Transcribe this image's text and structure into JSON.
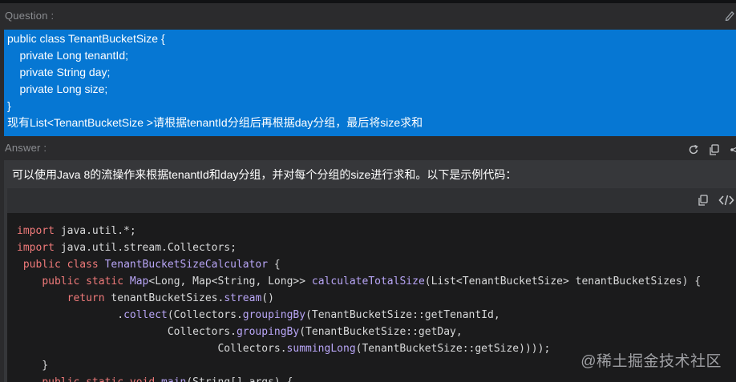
{
  "question": {
    "label": "Question :",
    "lines": [
      "public class TenantBucketSize {",
      "    private Long tenantId;",
      "    private String day;",
      "    private Long size;",
      "}",
      "现有List<TenantBucketSize >请根据tenantId分组后再根据day分组，最后将size求和"
    ]
  },
  "answer": {
    "label": "Answer :",
    "intro": "可以使用Java 8的流操作来根据tenantId和day分组，并对每个分组的size进行求和。以下是示例代码：",
    "tool_icons": [
      "refresh-icon",
      "copy-icon",
      "share-icon"
    ],
    "code_header_icons": [
      "copy-code-icon",
      "code-view-icon"
    ],
    "code_lines": [
      [
        {
          "t": "kw",
          "s": "import"
        },
        {
          "t": "plain",
          "s": " java.util.*;"
        }
      ],
      [
        {
          "t": "kw",
          "s": "import"
        },
        {
          "t": "plain",
          "s": " java.util.stream.Collectors;"
        }
      ],
      [
        {
          "t": "plain",
          "s": " "
        },
        {
          "t": "kw",
          "s": "public"
        },
        {
          "t": "plain",
          "s": " "
        },
        {
          "t": "kw",
          "s": "class"
        },
        {
          "t": "plain",
          "s": " "
        },
        {
          "t": "cls",
          "s": "TenantBucketSizeCalculator"
        },
        {
          "t": "plain",
          "s": " {"
        }
      ],
      [
        {
          "t": "plain",
          "s": "    "
        },
        {
          "t": "kw",
          "s": "public"
        },
        {
          "t": "plain",
          "s": " "
        },
        {
          "t": "kw",
          "s": "static"
        },
        {
          "t": "plain",
          "s": " "
        },
        {
          "t": "cls",
          "s": "Map"
        },
        {
          "t": "plain",
          "s": "<Long, Map<String, Long>> "
        },
        {
          "t": "fn",
          "s": "calculateTotalSize"
        },
        {
          "t": "plain",
          "s": "(List<TenantBucketSize> tenantBucketSizes) {"
        }
      ],
      [
        {
          "t": "plain",
          "s": "        "
        },
        {
          "t": "kw",
          "s": "return"
        },
        {
          "t": "plain",
          "s": " tenantBucketSizes."
        },
        {
          "t": "fn",
          "s": "stream"
        },
        {
          "t": "plain",
          "s": "()"
        }
      ],
      [
        {
          "t": "plain",
          "s": "                ."
        },
        {
          "t": "fn",
          "s": "collect"
        },
        {
          "t": "plain",
          "s": "(Collectors."
        },
        {
          "t": "fn",
          "s": "groupingBy"
        },
        {
          "t": "plain",
          "s": "(TenantBucketSize::getTenantId,"
        }
      ],
      [
        {
          "t": "plain",
          "s": "                        Collectors."
        },
        {
          "t": "fn",
          "s": "groupingBy"
        },
        {
          "t": "plain",
          "s": "(TenantBucketSize::getDay,"
        }
      ],
      [
        {
          "t": "plain",
          "s": "                                Collectors."
        },
        {
          "t": "fn",
          "s": "summingLong"
        },
        {
          "t": "plain",
          "s": "(TenantBucketSize::getSize))));"
        }
      ],
      [
        {
          "t": "plain",
          "s": "    }"
        }
      ],
      [
        {
          "t": "plain",
          "s": "    "
        },
        {
          "t": "kw",
          "s": "public"
        },
        {
          "t": "plain",
          "s": " "
        },
        {
          "t": "kw",
          "s": "static"
        },
        {
          "t": "plain",
          "s": " "
        },
        {
          "t": "kw",
          "s": "void"
        },
        {
          "t": "plain",
          "s": " "
        },
        {
          "t": "fn",
          "s": "main"
        },
        {
          "t": "plain",
          "s": "(String[] args) {"
        }
      ]
    ]
  },
  "watermark": "@稀土掘金技术社区",
  "colors": {
    "question_bg": "#0677d3",
    "keyword": "#f07a7a",
    "class_name": "#b9a6f7",
    "code_bg": "#1b1b1c"
  }
}
